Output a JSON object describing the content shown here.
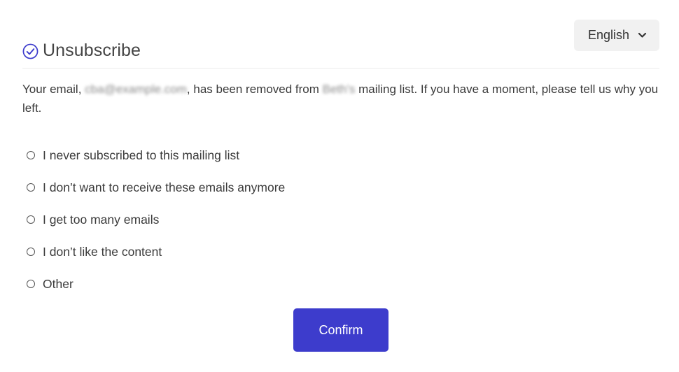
{
  "language_selector": {
    "label": "English",
    "icon": "chevron-down-icon"
  },
  "header": {
    "icon": "check-circle-icon",
    "title": "Unsubscribe",
    "accent_color": "#3d3ccc"
  },
  "message": {
    "prefix": "Your email, ",
    "email": "cba@example.com",
    "middle": ", has been removed from ",
    "sender": "Beth's",
    "suffix": " mailing list. If you have a moment, please tell us why you left."
  },
  "reasons": [
    {
      "label": "I never subscribed to this mailing list"
    },
    {
      "label": "I don’t want to receive these emails anymore"
    },
    {
      "label": "I get too many emails"
    },
    {
      "label": "I don’t like the content"
    },
    {
      "label": "Other"
    }
  ],
  "confirm_button": {
    "label": "Confirm",
    "color": "#3d3ccc"
  }
}
